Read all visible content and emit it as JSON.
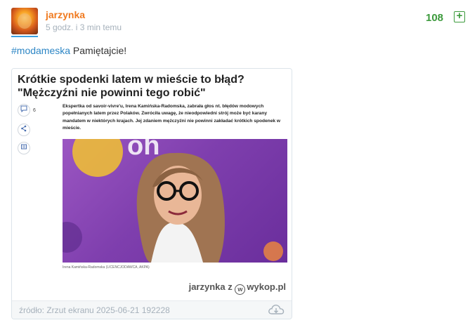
{
  "post": {
    "username": "jarzynka",
    "time": "5 godz. i 3 min temu",
    "votes": "108",
    "hashtag": "#modameska",
    "text": " Pamiętajcie!"
  },
  "embed": {
    "headline": "Krótkie spodenki latem w mieście to błąd? \"Mężczyźni nie powinni tego robić\"",
    "comment_count": "6",
    "lead": "Ekspertka od savoir-vivre'u, Irena Kamińska-Radomska, zabrała głos nt. błędów modowych popełnianych latem przez Polaków. Zwróciła uwagę, że nieodpowiedni strój może być karany mandatem w niektórych krajach. Jej zdaniem mężczyźni nie powinni zakładać krótkich spodenek w mieście.",
    "caption": "Irena Kamińska-Radomska (LICENCJODAWCA, AKPA)",
    "watermark_user": "jarzynka",
    "watermark_z": "z",
    "watermark_brand": "wykop.pl"
  },
  "source": "źródło: Zrzut ekranu 2025-06-21 192228",
  "colors": {
    "username": "#f07a1f",
    "votes": "#3c9a3c",
    "hashtag": "#2d86c5",
    "photo_background": "#7f3fae"
  },
  "icons": [
    "plus-icon",
    "comment-icon",
    "share-icon",
    "bookmark-icon",
    "download-icon",
    "wykop-logo-icon"
  ]
}
